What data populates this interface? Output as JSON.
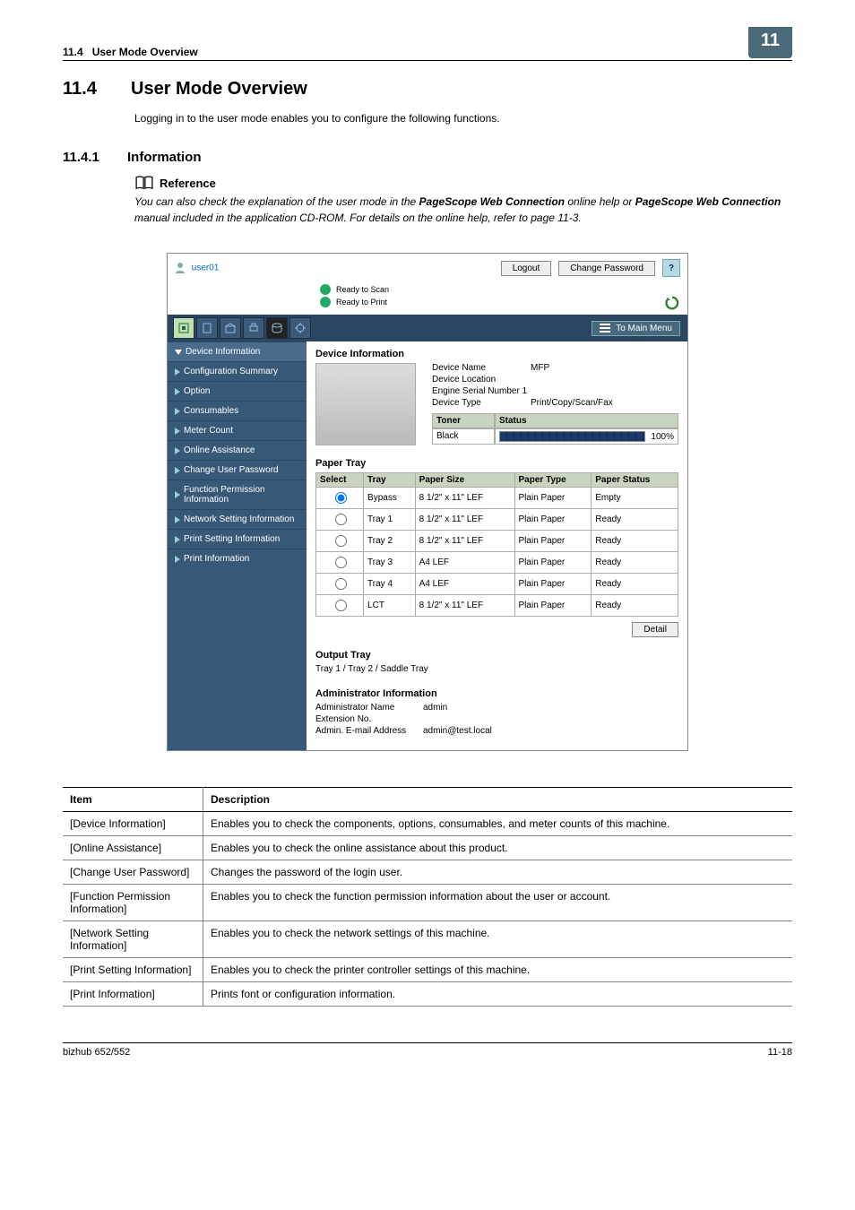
{
  "header": {
    "section_no": "11.4",
    "section_title": "User Mode Overview",
    "chapter_badge": "11"
  },
  "h1": {
    "no": "11.4",
    "title": "User Mode Overview"
  },
  "intro_para": "Logging in to the user mode enables you to configure the following functions.",
  "h2": {
    "no": "11.4.1",
    "title": "Information"
  },
  "reference": {
    "label": "Reference",
    "text_prefix": "You can also check the explanation of the user mode in the ",
    "bold1": "PageScope Web Connection",
    "text_mid": " online help or ",
    "bold2": "PageScope Web Connection",
    "text_suffix": " manual included in the application CD-ROM. For details on the online help, refer to page 11-3."
  },
  "screenshot": {
    "user": "user01",
    "logout_btn": "Logout",
    "changepwd_btn": "Change Password",
    "status_scan": "Ready to Scan",
    "status_print": "Ready to Print",
    "main_menu_btn": "To Main Menu",
    "sidebar": [
      "Device Information",
      "Configuration Summary",
      "Option",
      "Consumables",
      "Meter Count",
      "Online Assistance",
      "Change User Password",
      "Function Permission Information",
      "Network Setting Information",
      "Print Setting Information",
      "Print Information"
    ],
    "dev_info_title": "Device Information",
    "dev_kv": {
      "name_k": "Device Name",
      "name_v": "MFP",
      "loc_k": "Device Location",
      "loc_v": "",
      "serial_k": "Engine Serial Number 1",
      "serial_v": "",
      "type_k": "Device Type",
      "type_v": "Print/Copy/Scan/Fax"
    },
    "toner_hdr1": "Toner",
    "toner_hdr2": "Status",
    "toner_black": "Black",
    "toner_pct": "100%",
    "paper_tray_title": "Paper Tray",
    "paper_cols": [
      "Select",
      "Tray",
      "Paper Size",
      "Paper Type",
      "Paper Status"
    ],
    "paper_rows": [
      {
        "sel": true,
        "tray": "Bypass",
        "size": "8 1/2\" x 11\" LEF",
        "type": "Plain Paper",
        "status": "Empty"
      },
      {
        "sel": false,
        "tray": "Tray 1",
        "size": "8 1/2\" x 11\" LEF",
        "type": "Plain Paper",
        "status": "Ready"
      },
      {
        "sel": false,
        "tray": "Tray 2",
        "size": "8 1/2\" x 11\" LEF",
        "type": "Plain Paper",
        "status": "Ready"
      },
      {
        "sel": false,
        "tray": "Tray 3",
        "size": "A4 LEF",
        "type": "Plain Paper",
        "status": "Ready"
      },
      {
        "sel": false,
        "tray": "Tray 4",
        "size": "A4 LEF",
        "type": "Plain Paper",
        "status": "Ready"
      },
      {
        "sel": false,
        "tray": "LCT",
        "size": "8 1/2\" x 11\" LEF",
        "type": "Plain Paper",
        "status": "Ready"
      }
    ],
    "detail_btn": "Detail",
    "output_tray_title": "Output Tray",
    "output_tray_val": "Tray 1 / Tray 2 / Saddle Tray",
    "admin_title": "Administrator Information",
    "admin_kv": {
      "name_k": "Administrator Name",
      "name_v": "admin",
      "ext_k": "Extension No.",
      "ext_v": "",
      "mail_k": "Admin. E-mail Address",
      "mail_v": "admin@test.local"
    }
  },
  "desc_table": {
    "head_item": "Item",
    "head_desc": "Description",
    "rows": [
      {
        "item": "[Device Information]",
        "desc": "Enables you to check the components, options, consumables, and meter counts of this machine."
      },
      {
        "item": "[Online Assistance]",
        "desc": "Enables you to check the online assistance about this product."
      },
      {
        "item": "[Change User Password]",
        "desc": "Changes the password of the login user."
      },
      {
        "item": "[Function Permission Information]",
        "desc": "Enables you to check the function permission information about the user or account."
      },
      {
        "item": "[Network Setting Information]",
        "desc": "Enables you to check the network settings of this machine."
      },
      {
        "item": "[Print Setting Information]",
        "desc": "Enables you to check the printer controller settings of this machine."
      },
      {
        "item": "[Print Information]",
        "desc": "Prints font or configuration information."
      }
    ]
  },
  "footer": {
    "left": "bizhub 652/552",
    "right": "11-18"
  }
}
